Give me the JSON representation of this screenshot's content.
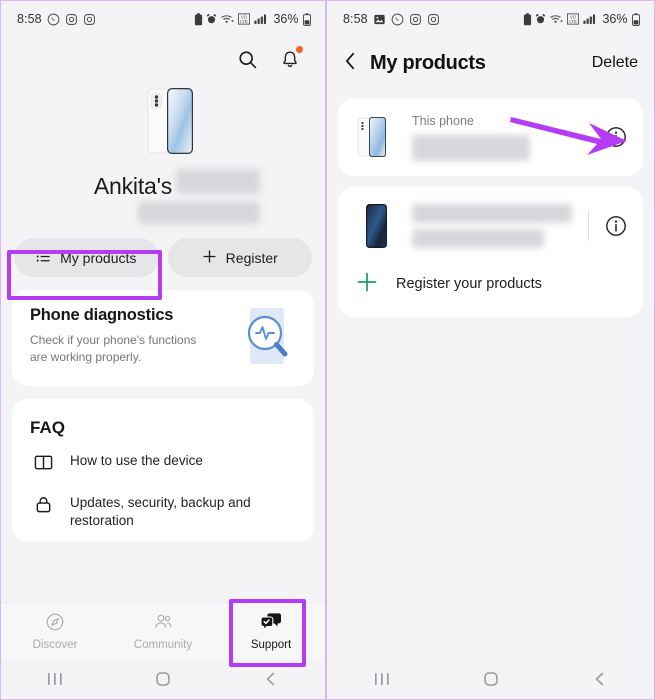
{
  "meta": {
    "accent_purple": "#b53cf5",
    "badge_orange": "#f5621d",
    "register_plus_green": "#17a066"
  },
  "left_panel": {
    "status_bar": {
      "time": "8:58",
      "battery_percent": "36%",
      "left_icons": [
        "whatsapp-icon",
        "instagram-icon",
        "instagram-icon"
      ],
      "right_icons": [
        "battery-saver-icon",
        "alarm-icon",
        "wifi-calling-icon",
        "vowifi-icon",
        "signal-icon"
      ]
    },
    "top_actions": [
      {
        "name": "search-icon",
        "label": "Search"
      },
      {
        "name": "notifications-icon",
        "label": "Notifications",
        "badge": true
      }
    ],
    "hero": {
      "device_image": "galaxy-s21-fe-white",
      "user_name": "Ankita's",
      "redacted_device_name": true
    },
    "chips": [
      {
        "icon": "list-icon",
        "label": "My products",
        "highlighted": true
      },
      {
        "icon": "plus-icon",
        "label": "Register",
        "highlighted": false
      }
    ],
    "diagnostics": {
      "title": "Phone diagnostics",
      "subtitle": "Check if your phone's functions are working properly.",
      "art": "magnifier-pulse-icon"
    },
    "faq": {
      "title": "FAQ",
      "items": [
        {
          "icon": "book-icon",
          "label": "How to use the device"
        },
        {
          "icon": "lock-icon",
          "label": "Updates, security, backup and restoration"
        }
      ]
    },
    "bottom_nav": [
      {
        "icon": "compass-icon",
        "label": "Discover",
        "active": false
      },
      {
        "icon": "people-icon",
        "label": "Community",
        "active": false
      },
      {
        "icon": "support-chat-icon",
        "label": "Support",
        "active": true,
        "highlighted": true
      }
    ],
    "gesture_bar": [
      "recents-icon",
      "home-icon",
      "back-icon"
    ]
  },
  "right_panel": {
    "status_bar": {
      "time": "8:58",
      "battery_percent": "36%",
      "left_icons": [
        "gallery-icon",
        "whatsapp-icon",
        "instagram-icon",
        "instagram-icon"
      ],
      "right_icons": [
        "battery-saver-icon",
        "alarm-icon",
        "wifi-calling-icon",
        "vowifi-icon",
        "signal-icon"
      ]
    },
    "app_bar": {
      "back_icon": "chevron-left-icon",
      "title": "My products",
      "action_label": "Delete"
    },
    "products": [
      {
        "thumb": "galaxy-s21-fe-white",
        "label": "This phone",
        "name_redacted": true,
        "info_icon": "info-icon",
        "has_divider": false,
        "annotated_arrow": true
      },
      {
        "thumb": "galaxy-a8-dark",
        "label": "",
        "name_redacted": true,
        "info_icon": "info-icon",
        "has_divider": true,
        "annotated_arrow": false
      }
    ],
    "register_row": {
      "icon": "plus-icon",
      "label": "Register your products"
    },
    "gesture_bar": [
      "recents-icon",
      "home-icon",
      "back-icon"
    ]
  }
}
